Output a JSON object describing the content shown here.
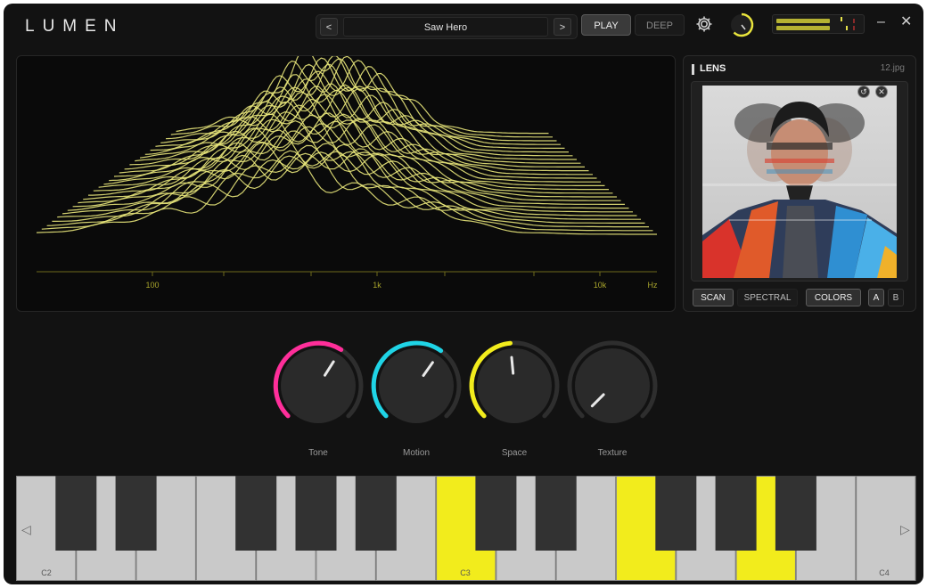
{
  "app": {
    "logo": "LUMEN"
  },
  "header": {
    "prev_label": "<",
    "next_label": ">",
    "preset_name": "Saw Hero",
    "mode_play": "PLAY",
    "mode_deep": "DEEP",
    "minimize": "–",
    "close": "✕",
    "meter": {
      "left_level": 0.62,
      "right_level": 0.62
    },
    "colors": {
      "accent": "#e8e43c",
      "meter": "#b5b232"
    }
  },
  "spectrum": {
    "freq_labels": [
      "100",
      "1k",
      "10k",
      "Hz"
    ],
    "line_color": "#e8e67a"
  },
  "lens": {
    "title": "LENS",
    "file": "12.jpg",
    "reset_icon": "↺",
    "remove_icon": "✕",
    "buttons": {
      "scan": "SCAN",
      "spectral": "SPECTRAL",
      "colors": "COLORS",
      "a": "A",
      "b": "B"
    }
  },
  "knobs": [
    {
      "label": "Tone",
      "value": 0.62,
      "color": "#ff2e9a"
    },
    {
      "label": "Motion",
      "value": 0.63,
      "color": "#1fd4e6"
    },
    {
      "label": "Space",
      "value": 0.48,
      "color": "#f2ec1c"
    },
    {
      "label": "Texture",
      "value": 0.0,
      "color": "#cfcfcf"
    }
  ],
  "keyboard": {
    "octave_labels": [
      "C2",
      "C3",
      "C4"
    ],
    "active_keys": [
      "C3",
      "F3",
      "A3"
    ],
    "nav_left": "◁",
    "nav_right": "▷",
    "active_color": "#f2ec1c"
  }
}
